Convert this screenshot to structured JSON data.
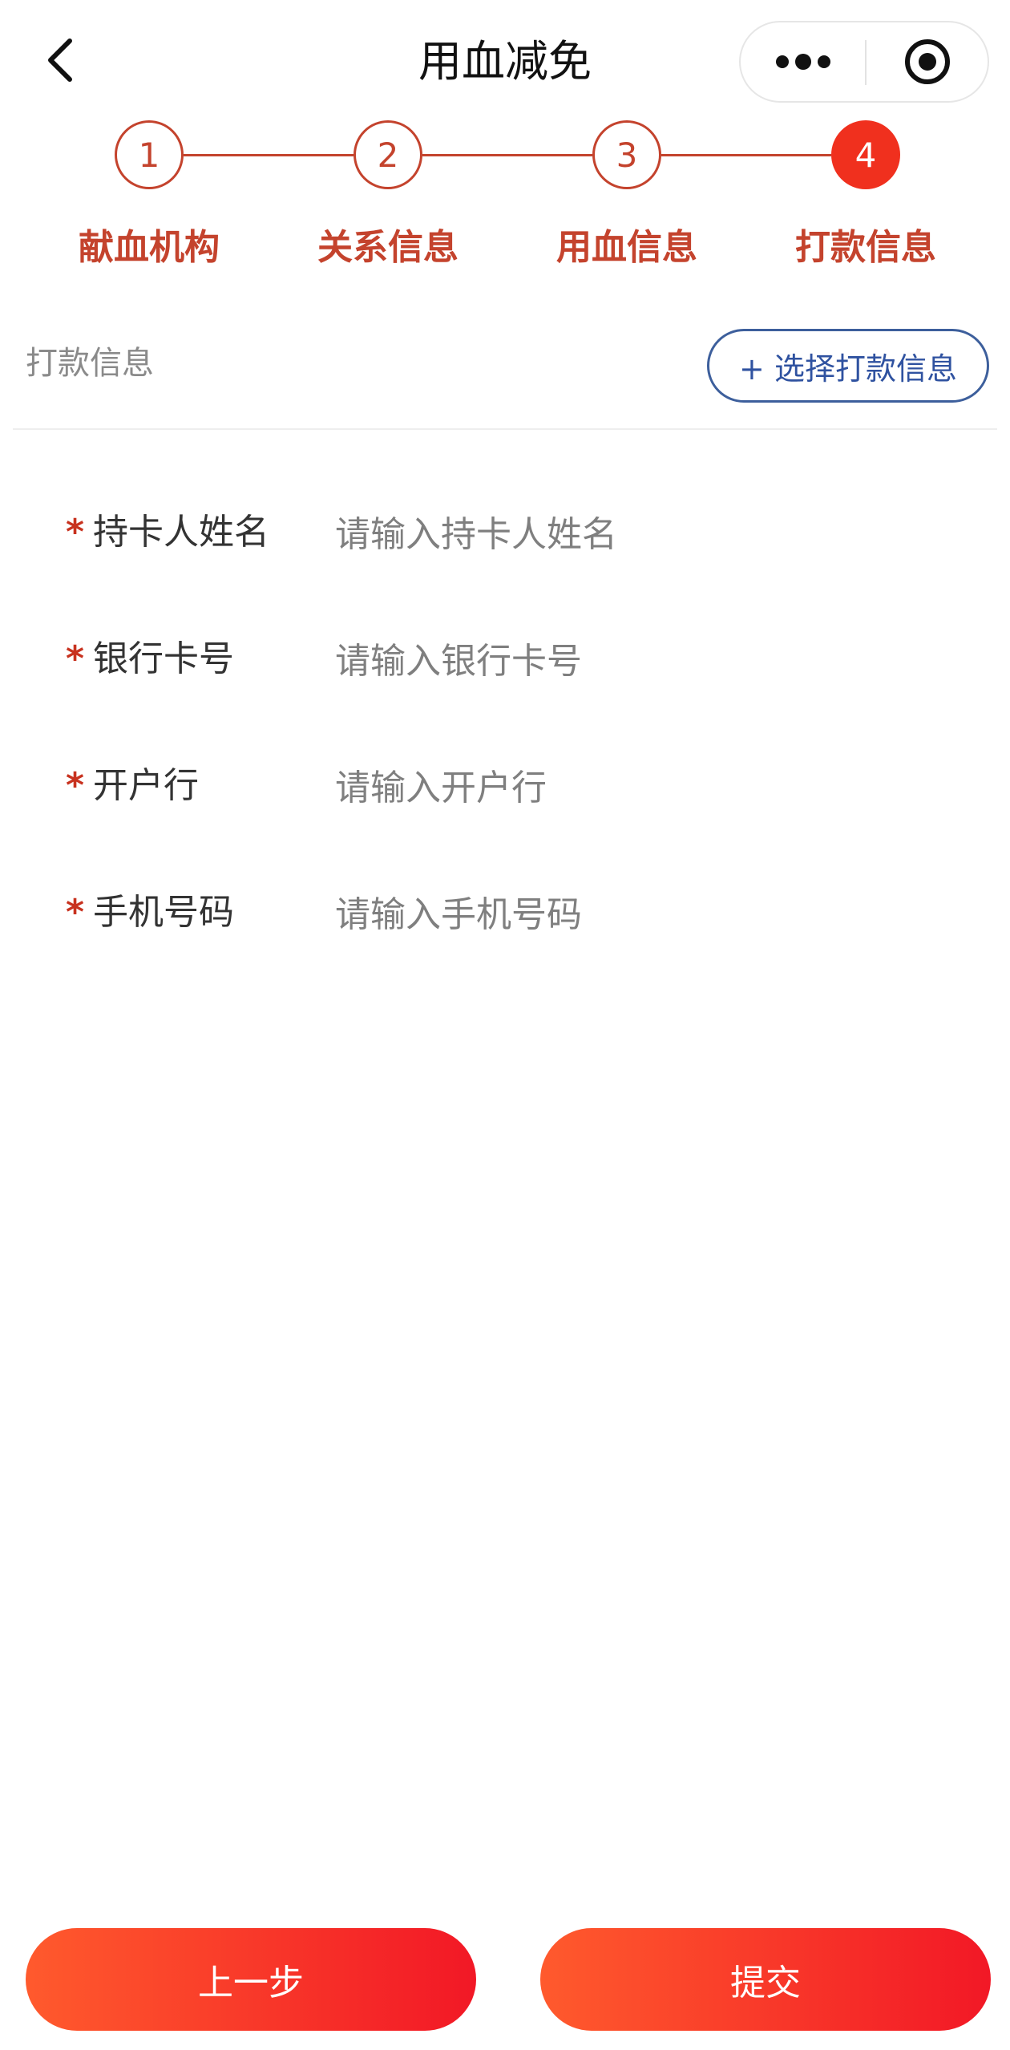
{
  "nav": {
    "title": "用血减免"
  },
  "stepper": {
    "steps": [
      {
        "number": "1",
        "label": "献血机构"
      },
      {
        "number": "2",
        "label": "关系信息"
      },
      {
        "number": "3",
        "label": "用血信息"
      },
      {
        "number": "4",
        "label": "打款信息"
      }
    ],
    "current_step": 4
  },
  "section": {
    "title": "打款信息",
    "select_button": "+ 选择打款信息"
  },
  "form": {
    "required_mark": "*",
    "fields": [
      {
        "label": "持卡人姓名",
        "placeholder": "请输入持卡人姓名",
        "value": ""
      },
      {
        "label": "银行卡号",
        "placeholder": "请输入银行卡号",
        "value": ""
      },
      {
        "label": "开户行",
        "placeholder": "请输入开户行",
        "value": ""
      },
      {
        "label": "手机号码",
        "placeholder": "请输入手机号码",
        "value": ""
      }
    ]
  },
  "footer": {
    "prev_label": "上一步",
    "submit_label": "提交"
  },
  "colors": {
    "accent": "#c4432d",
    "active_step": "#f0301e",
    "link_blue": "#2f52a0",
    "button_gradient_start": "#ff5a2d",
    "button_gradient_end": "#f21826"
  },
  "icons": {
    "back": "back-chevron-icon",
    "more": "more-dots-icon",
    "close": "target-circle-icon"
  }
}
